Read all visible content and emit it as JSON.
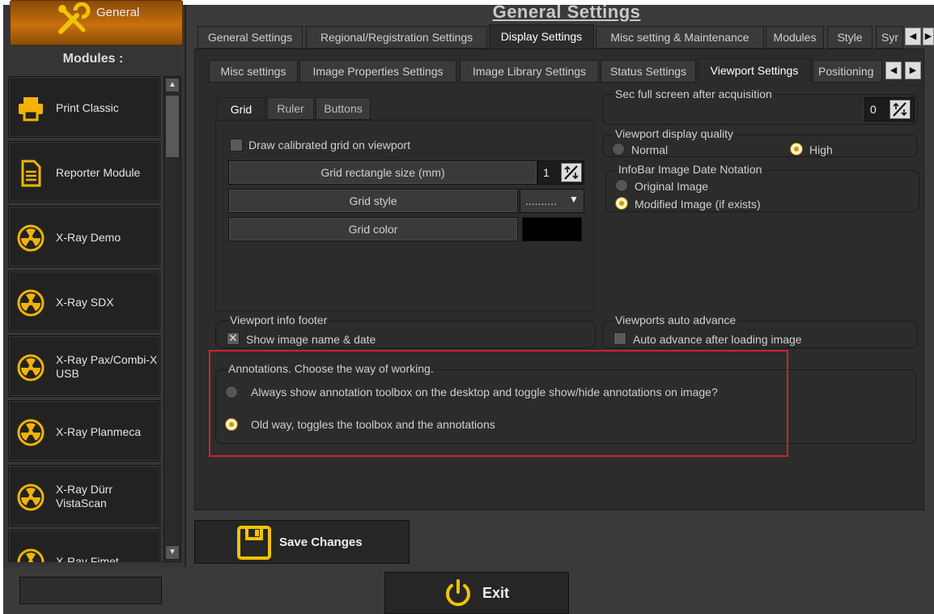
{
  "header": {
    "title": "General Settings"
  },
  "sidebar": {
    "general_label": "General",
    "modules_title": "Modules :",
    "items": [
      {
        "label": "Print Classic",
        "icon": "printer-icon"
      },
      {
        "label": "Reporter Module",
        "icon": "document-icon"
      },
      {
        "label": "X-Ray Demo",
        "icon": "radiation-icon"
      },
      {
        "label": "X-Ray SDX",
        "icon": "radiation-icon"
      },
      {
        "label": "X-Ray Pax/Combi-X USB",
        "icon": "radiation-icon"
      },
      {
        "label": "X-Ray Planmeca",
        "icon": "radiation-icon"
      },
      {
        "label": "X-Ray Dürr VistaScan",
        "icon": "radiation-icon"
      },
      {
        "label": "X-Ray Fimet",
        "icon": "radiation-icon"
      }
    ]
  },
  "main_tabs": [
    {
      "label": "General Settings",
      "active": false
    },
    {
      "label": "Regional/Registration Settings",
      "active": false
    },
    {
      "label": "Display Settings",
      "active": true
    },
    {
      "label": "Misc setting & Maintenance",
      "active": false
    },
    {
      "label": "Modules",
      "active": false
    },
    {
      "label": "Style",
      "active": false
    },
    {
      "label": "Syr",
      "active": false
    }
  ],
  "sub_tabs": [
    {
      "label": "Misc settings",
      "active": false
    },
    {
      "label": "Image Properties Settings",
      "active": false
    },
    {
      "label": "Image Library Settings",
      "active": false
    },
    {
      "label": "Status Settings",
      "active": false
    },
    {
      "label": "Viewport Settings",
      "active": true
    },
    {
      "label": "Positioning",
      "active": false
    }
  ],
  "grid_tabs": [
    {
      "label": "Grid",
      "active": true
    },
    {
      "label": "Ruler",
      "active": false
    },
    {
      "label": "Buttons",
      "active": false
    }
  ],
  "grid": {
    "draw_calibrated_label": "Draw calibrated grid on viewport",
    "draw_calibrated_checked": false,
    "rect_size_label": "Grid rectangle size (mm)",
    "rect_size_value": "1",
    "style_label": "Grid style",
    "style_value": "..........",
    "color_label": "Grid color",
    "color_value": "#000000"
  },
  "fullscreen": {
    "title": "Sec full screen after acquisition",
    "value": "0"
  },
  "display_quality": {
    "title": "Viewport display quality",
    "normal": "Normal",
    "high": "High",
    "selected": "High"
  },
  "infobar": {
    "title": "InfoBar Image Date Notation",
    "original": "Original Image",
    "modified": "Modified Image (if exists)",
    "selected": "Modified Image (if exists)"
  },
  "footer_info": {
    "title": "Viewport info footer",
    "label": "Show image name & date",
    "checked": true
  },
  "auto_advance": {
    "title": "Viewports auto advance",
    "label": "Auto advance after loading image",
    "checked": false
  },
  "annotations": {
    "title": "Annotations. Choose the way of working.",
    "option1": "Always show annotation toolbox on the desktop and toggle show/hide annotations on image?",
    "option2": "Old way, toggles the toolbox and the annotations",
    "selected": "option2"
  },
  "buttons": {
    "save": "Save Changes",
    "exit": "Exit"
  },
  "colors": {
    "accent": "#e8b800",
    "highlight": "#d02030",
    "general_button": "#c8700e"
  }
}
